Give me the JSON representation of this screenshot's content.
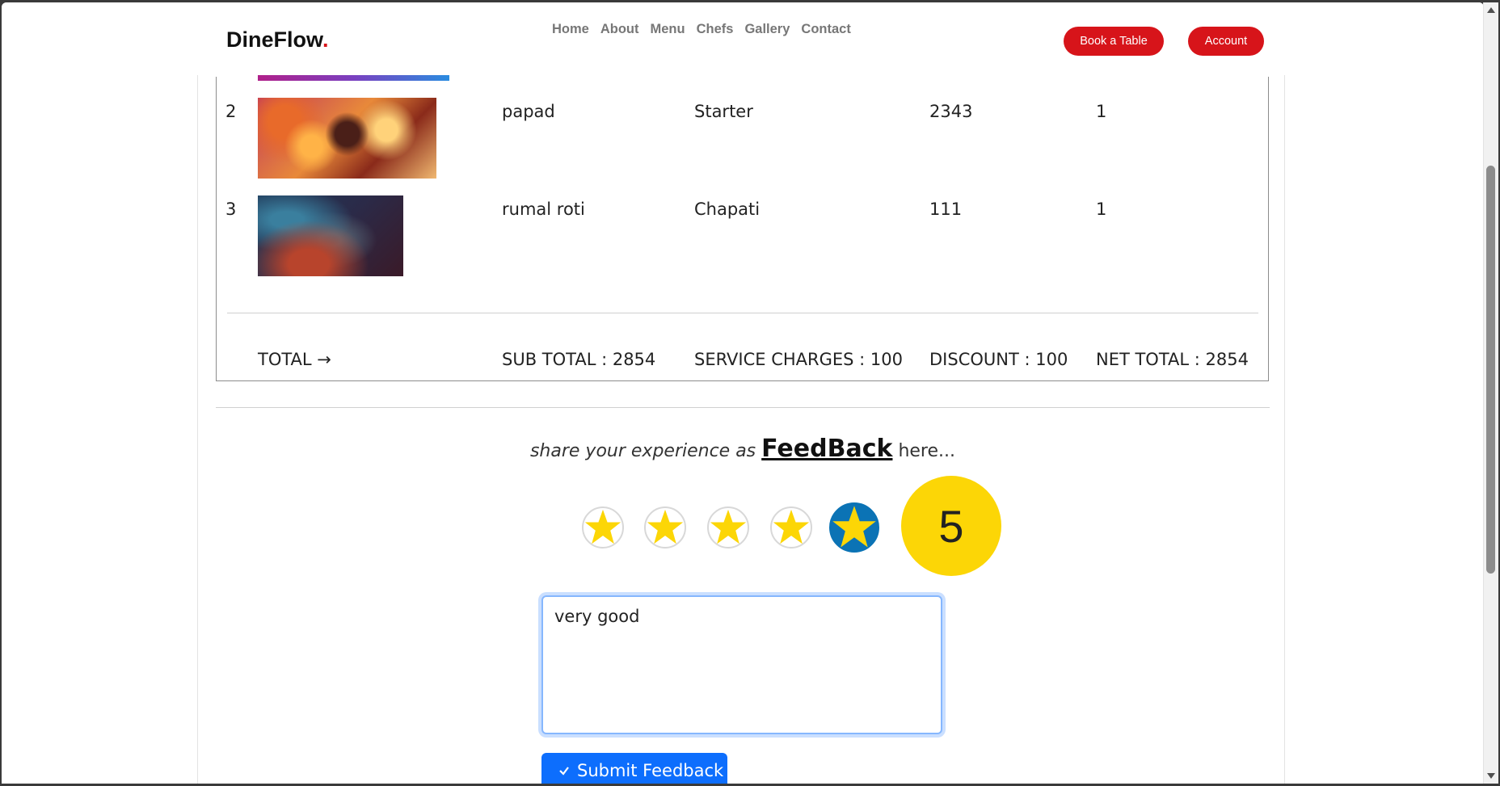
{
  "header": {
    "logo_text": "DineFlow",
    "logo_dot": ".",
    "nav": [
      "Home",
      "About",
      "Menu",
      "Chefs",
      "Gallery",
      "Contact"
    ],
    "book_button": "Book a Table",
    "account_button": "Account"
  },
  "colors": {
    "brand_red": "#d7141a",
    "primary_blue": "#0d6efd",
    "star_yellow": "#fcd606",
    "active_star_bg": "#0b73b5"
  },
  "order": {
    "rows": [
      {
        "no": "2",
        "name": "papad",
        "category": "Starter",
        "price": "2343",
        "qty": "1"
      },
      {
        "no": "3",
        "name": "rumal roti",
        "category": "Chapati",
        "price": "111",
        "qty": "1"
      }
    ],
    "totals": {
      "label": "TOTAL →",
      "sub_total": "SUB TOTAL : 2854",
      "service_charges": "SERVICE CHARGES : 100",
      "discount": "DISCOUNT : 100",
      "net_total": "NET TOTAL : 2854"
    }
  },
  "feedback": {
    "prompt_before": "share your experience as",
    "prompt_link": "FeedBack",
    "prompt_after": "here...",
    "rating": "5",
    "star_icons": [
      "star-icon",
      "star-icon",
      "star-icon",
      "star-icon",
      "star-icon"
    ],
    "comment_value": "very good",
    "submit_label": "Submit Feedback",
    "submit_icon": "check-icon"
  }
}
